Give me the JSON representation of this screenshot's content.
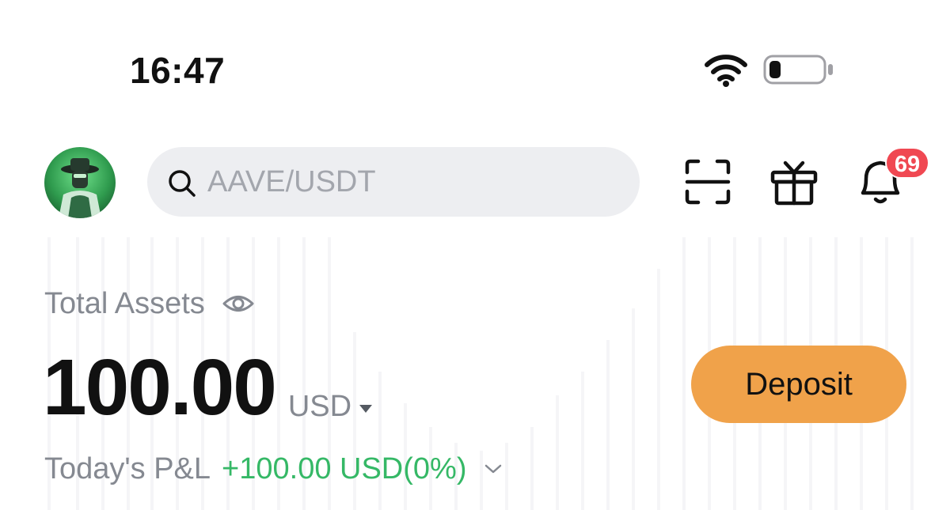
{
  "status_bar": {
    "time": "16:47",
    "wifi_icon": "wifi-icon",
    "battery_icon": "battery-low-icon",
    "battery_level_fraction": 0.15
  },
  "header": {
    "avatar_icon": "user-avatar",
    "search": {
      "icon": "search-icon",
      "placeholder": "AAVE/USDT",
      "value": ""
    },
    "scan_icon": "scan-icon",
    "gift_icon": "gift-icon",
    "notifications": {
      "icon": "bell-icon",
      "badge_count": "69",
      "badge_color": "#f04852"
    }
  },
  "assets": {
    "label": "Total Assets",
    "visibility_icon": "eye-icon",
    "amount": "100.00",
    "currency": "USD",
    "currency_dropdown_icon": "caret-down-icon",
    "deposit_label": "Deposit",
    "deposit_color": "#f0a24a",
    "pnl_label": "Today's P&L",
    "pnl_value": "+100.00 USD(0%)",
    "pnl_color": "#35b866",
    "pnl_expand_icon": "chevron-down-icon"
  }
}
